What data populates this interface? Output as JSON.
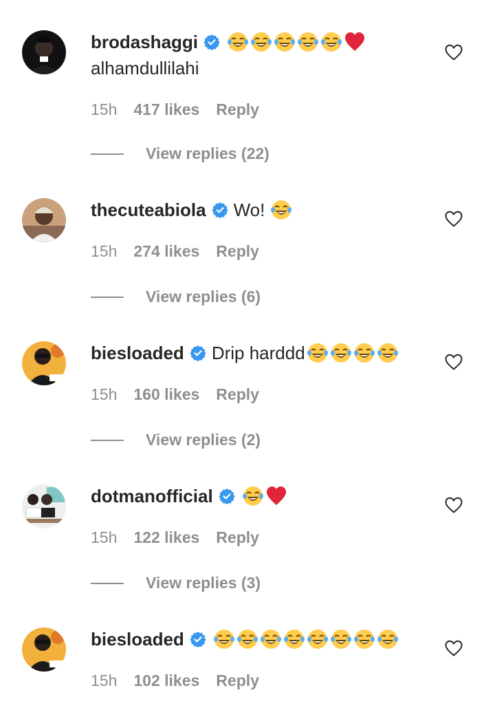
{
  "comments": [
    {
      "username": "brodashaggi",
      "inline_text": "",
      "body": "alhamdullilahi",
      "emojis": [
        "laughing-tears-emoji",
        "laughing-tears-emoji",
        "laughing-tears-emoji",
        "laughing-tears-emoji",
        "laughing-tears-emoji",
        "red-heart-emoji"
      ],
      "time": "15h",
      "likes": "417 likes",
      "reply": "Reply",
      "view_replies": "View replies (22)"
    },
    {
      "username": "thecuteabiola",
      "inline_text": "Wo!",
      "body": "",
      "emojis": [
        "laughing-tears-emoji"
      ],
      "time": "15h",
      "likes": "274 likes",
      "reply": "Reply",
      "view_replies": "View replies (6)"
    },
    {
      "username": "biesloaded",
      "inline_text": "Drip harddd",
      "body": "",
      "emojis": [
        "laughing-tears-emoji",
        "laughing-tears-emoji",
        "laughing-tears-emoji",
        "laughing-tears-emoji"
      ],
      "time": "15h",
      "likes": "160 likes",
      "reply": "Reply",
      "view_replies": "View replies (2)"
    },
    {
      "username": "dotmanofficial",
      "inline_text": "",
      "body": "",
      "emojis": [
        "laughing-tears-emoji",
        "red-heart-emoji"
      ],
      "time": "15h",
      "likes": "122 likes",
      "reply": "Reply",
      "view_replies": "View replies (3)"
    },
    {
      "username": "biesloaded",
      "inline_text": "",
      "body": "",
      "emojis": [
        "laughing-tears-emoji",
        "laughing-tears-emoji",
        "laughing-tears-emoji",
        "laughing-tears-emoji",
        "laughing-tears-emoji",
        "laughing-tears-emoji",
        "laughing-tears-emoji",
        "laughing-tears-emoji"
      ],
      "time": "15h",
      "likes": "102 likes",
      "reply": "Reply",
      "view_replies": ""
    }
  ],
  "icons": {
    "verified": "verified-badge-icon",
    "like": "heart-outline-icon"
  },
  "colors": {
    "text": "#262626",
    "secondary": "#8e8e8e",
    "verified": "#3897f0",
    "heart_emoji": "#e0243a"
  }
}
